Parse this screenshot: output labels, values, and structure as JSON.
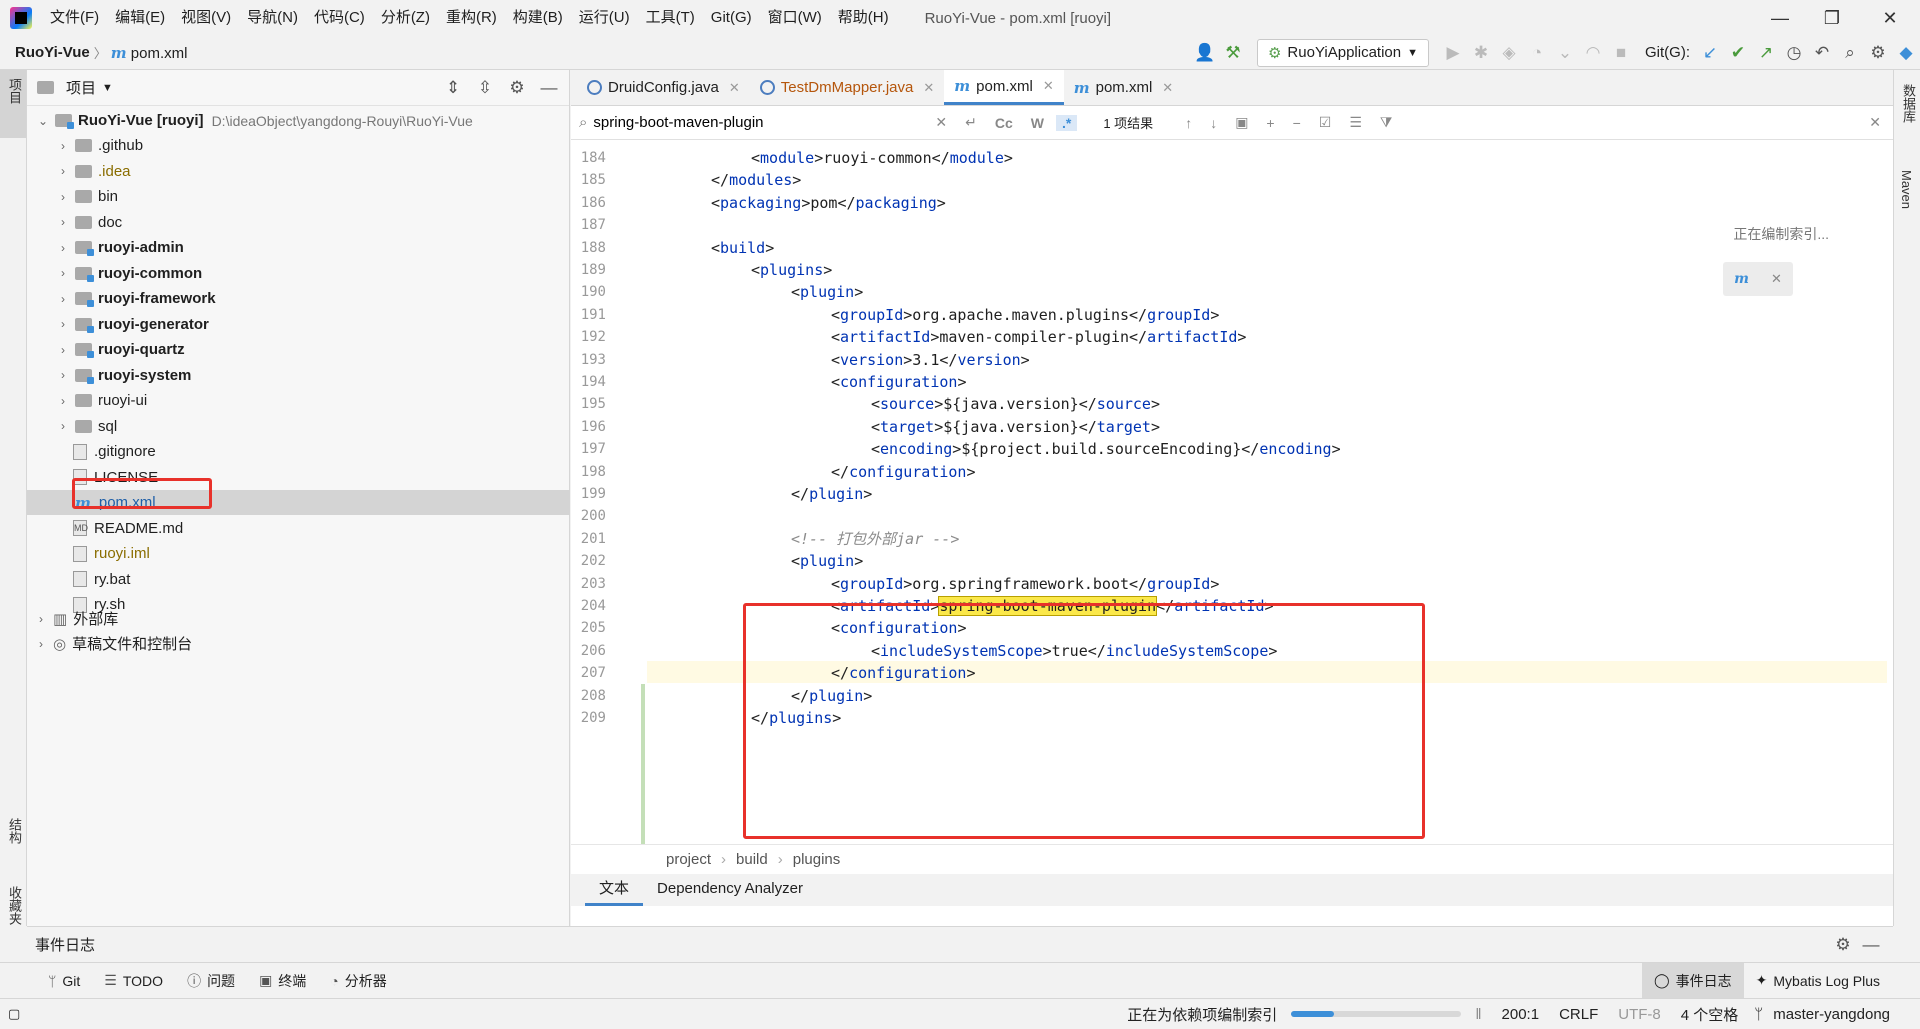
{
  "window": {
    "title": "RuoYi-Vue - pom.xml [ruoyi]",
    "minimize": "—",
    "maximize": "❐",
    "close": "✕"
  },
  "menu": [
    "文件(F)",
    "编辑(E)",
    "视图(V)",
    "导航(N)",
    "代码(C)",
    "分析(Z)",
    "重构(R)",
    "构建(B)",
    "运行(U)",
    "工具(T)",
    "Git(G)",
    "窗口(W)",
    "帮助(H)"
  ],
  "navbar": {
    "project": "RuoYi-Vue",
    "file": "pom.xml",
    "run_config": "RuoYiApplication",
    "git_label": "Git(G):"
  },
  "left_stripe": {
    "project": "项目",
    "structure": "结构",
    "favorites": "收藏夹"
  },
  "right_stripe": {
    "database": "数据库",
    "maven": "Maven"
  },
  "project_panel": {
    "title": "项目",
    "root_name": "RuoYi-Vue [ruoyi]",
    "root_path": "D:\\ideaObject\\yangdong-Rouyi\\RuoYi-Vue",
    "items": [
      {
        "label": ".github",
        "kind": "folder"
      },
      {
        "label": ".idea",
        "kind": "folder-orange"
      },
      {
        "label": "bin",
        "kind": "folder"
      },
      {
        "label": "doc",
        "kind": "folder"
      },
      {
        "label": "ruoyi-admin",
        "kind": "module"
      },
      {
        "label": "ruoyi-common",
        "kind": "module"
      },
      {
        "label": "ruoyi-framework",
        "kind": "module"
      },
      {
        "label": "ruoyi-generator",
        "kind": "module"
      },
      {
        "label": "ruoyi-quartz",
        "kind": "module"
      },
      {
        "label": "ruoyi-system",
        "kind": "module"
      },
      {
        "label": "ruoyi-ui",
        "kind": "folder"
      },
      {
        "label": "sql",
        "kind": "folder"
      },
      {
        "label": ".gitignore",
        "kind": "file"
      },
      {
        "label": "LICENSE",
        "kind": "file"
      },
      {
        "label": "pom.xml",
        "kind": "maven"
      },
      {
        "label": "README.md",
        "kind": "md"
      },
      {
        "label": "ruoyi.iml",
        "kind": "file-orange"
      },
      {
        "label": "ry.bat",
        "kind": "file"
      },
      {
        "label": "ry.sh",
        "kind": "file"
      }
    ],
    "external_libs": "外部库",
    "scratches": "草稿文件和控制台"
  },
  "tabs": [
    {
      "label": "DruidConfig.java",
      "active": false
    },
    {
      "label": "TestDmMapper.java",
      "active": false
    },
    {
      "label": "pom.xml",
      "active": true
    },
    {
      "label": "pom.xml",
      "active": false
    }
  ],
  "search": {
    "value": "spring-boot-maven-plugin",
    "case_btn": "Cc",
    "word_btn": "W",
    "regex_btn": ".*",
    "result": "1 项结果"
  },
  "editor": {
    "indexing_note": "正在编制索引...",
    "lines": [
      {
        "n": "184",
        "indent": 2,
        "parts": [
          [
            "br",
            "<"
          ],
          [
            "tag",
            "module"
          ],
          [
            "br",
            ">"
          ],
          [
            "txt",
            "ruoyi-common"
          ],
          [
            "br",
            "</"
          ],
          [
            "tag",
            "module"
          ],
          [
            "br",
            ">"
          ]
        ]
      },
      {
        "n": "185",
        "indent": 1,
        "parts": [
          [
            "br",
            "</"
          ],
          [
            "tag",
            "modules"
          ],
          [
            "br",
            ">"
          ]
        ]
      },
      {
        "n": "186",
        "indent": 1,
        "parts": [
          [
            "br",
            "<"
          ],
          [
            "tag",
            "packaging"
          ],
          [
            "br",
            ">"
          ],
          [
            "txt",
            "pom"
          ],
          [
            "br",
            "</"
          ],
          [
            "tag",
            "packaging"
          ],
          [
            "br",
            ">"
          ]
        ]
      },
      {
        "n": "187",
        "indent": 0,
        "parts": []
      },
      {
        "n": "188",
        "indent": 1,
        "parts": [
          [
            "br",
            "<"
          ],
          [
            "tag",
            "build"
          ],
          [
            "br",
            ">"
          ]
        ]
      },
      {
        "n": "189",
        "indent": 2,
        "parts": [
          [
            "br",
            "<"
          ],
          [
            "tag",
            "plugins"
          ],
          [
            "br",
            ">"
          ]
        ]
      },
      {
        "n": "190",
        "indent": 3,
        "parts": [
          [
            "br",
            "<"
          ],
          [
            "tag",
            "plugin"
          ],
          [
            "br",
            ">"
          ]
        ]
      },
      {
        "n": "191",
        "indent": 4,
        "parts": [
          [
            "br",
            "<"
          ],
          [
            "tag",
            "groupId"
          ],
          [
            "br",
            ">"
          ],
          [
            "txt",
            "org.apache.maven.plugins"
          ],
          [
            "br",
            "</"
          ],
          [
            "tag",
            "groupId"
          ],
          [
            "br",
            ">"
          ]
        ]
      },
      {
        "n": "192",
        "indent": 4,
        "parts": [
          [
            "br",
            "<"
          ],
          [
            "tag",
            "artifactId"
          ],
          [
            "br",
            ">"
          ],
          [
            "txt",
            "maven-compiler-plugin"
          ],
          [
            "br",
            "</"
          ],
          [
            "tag",
            "artifactId"
          ],
          [
            "br",
            ">"
          ]
        ]
      },
      {
        "n": "193",
        "indent": 4,
        "parts": [
          [
            "br",
            "<"
          ],
          [
            "tag",
            "version"
          ],
          [
            "br",
            ">"
          ],
          [
            "txt",
            "3.1"
          ],
          [
            "br",
            "</"
          ],
          [
            "tag",
            "version"
          ],
          [
            "br",
            ">"
          ]
        ]
      },
      {
        "n": "194",
        "indent": 4,
        "parts": [
          [
            "br",
            "<"
          ],
          [
            "tag",
            "configuration"
          ],
          [
            "br",
            ">"
          ]
        ]
      },
      {
        "n": "195",
        "indent": 5,
        "parts": [
          [
            "br",
            "<"
          ],
          [
            "tag",
            "source"
          ],
          [
            "br",
            ">"
          ],
          [
            "txt",
            "${java.version}"
          ],
          [
            "br",
            "</"
          ],
          [
            "tag",
            "source"
          ],
          [
            "br",
            ">"
          ]
        ]
      },
      {
        "n": "196",
        "indent": 5,
        "parts": [
          [
            "br",
            "<"
          ],
          [
            "tag",
            "target"
          ],
          [
            "br",
            ">"
          ],
          [
            "txt",
            "${java.version}"
          ],
          [
            "br",
            "</"
          ],
          [
            "tag",
            "target"
          ],
          [
            "br",
            ">"
          ]
        ]
      },
      {
        "n": "197",
        "indent": 5,
        "parts": [
          [
            "br",
            "<"
          ],
          [
            "tag",
            "encoding"
          ],
          [
            "br",
            ">"
          ],
          [
            "txt",
            "${project.build.sourceEncoding}"
          ],
          [
            "br",
            "</"
          ],
          [
            "tag",
            "encoding"
          ],
          [
            "br",
            ">"
          ]
        ]
      },
      {
        "n": "198",
        "indent": 4,
        "parts": [
          [
            "br",
            "</"
          ],
          [
            "tag",
            "configuration"
          ],
          [
            "br",
            ">"
          ]
        ]
      },
      {
        "n": "199",
        "indent": 3,
        "parts": [
          [
            "br",
            "</"
          ],
          [
            "tag",
            "plugin"
          ],
          [
            "br",
            ">"
          ]
        ]
      },
      {
        "n": "200",
        "indent": 0,
        "parts": []
      },
      {
        "n": "201",
        "indent": 3,
        "parts": [
          [
            "cmt",
            "<!-- 打包外部jar -->"
          ]
        ]
      },
      {
        "n": "202",
        "indent": 3,
        "parts": [
          [
            "br",
            "<"
          ],
          [
            "tag",
            "plugin"
          ],
          [
            "br",
            ">"
          ]
        ]
      },
      {
        "n": "203",
        "indent": 4,
        "parts": [
          [
            "br",
            "<"
          ],
          [
            "tag",
            "groupId"
          ],
          [
            "br",
            ">"
          ],
          [
            "txt",
            "org.springframework.boot"
          ],
          [
            "br",
            "</"
          ],
          [
            "tag",
            "groupId"
          ],
          [
            "br",
            ">"
          ]
        ]
      },
      {
        "n": "204",
        "indent": 4,
        "parts": [
          [
            "br",
            "<"
          ],
          [
            "tag",
            "artifactId"
          ],
          [
            "br",
            ">"
          ],
          [
            "hl",
            "spring-boot-maven-plugin"
          ],
          [
            "br",
            "</"
          ],
          [
            "tag",
            "artifactId"
          ],
          [
            "br",
            ">"
          ]
        ]
      },
      {
        "n": "205",
        "indent": 4,
        "parts": [
          [
            "br",
            "<"
          ],
          [
            "tag",
            "configuration"
          ],
          [
            "br",
            ">"
          ]
        ]
      },
      {
        "n": "206",
        "indent": 5,
        "parts": [
          [
            "br",
            "<"
          ],
          [
            "tag",
            "includeSystemScope"
          ],
          [
            "br",
            ">"
          ],
          [
            "txt",
            "true"
          ],
          [
            "br",
            "</"
          ],
          [
            "tag",
            "includeSystemScope"
          ],
          [
            "br",
            ">"
          ]
        ]
      },
      {
        "n": "207",
        "indent": 4,
        "parts": [
          [
            "br",
            "</"
          ],
          [
            "tag",
            "configuration"
          ],
          [
            "br",
            ">"
          ]
        ]
      },
      {
        "n": "208",
        "indent": 3,
        "parts": [
          [
            "br",
            "</"
          ],
          [
            "tag",
            "plugin"
          ],
          [
            "br",
            ">"
          ]
        ]
      },
      {
        "n": "209",
        "indent": 2,
        "parts": [
          [
            "br",
            "</"
          ],
          [
            "tag",
            "plugins"
          ],
          [
            "br",
            ">"
          ]
        ]
      }
    ],
    "breadcrumb": [
      "project",
      "build",
      "plugins"
    ],
    "bottom_tabs": [
      {
        "label": "文本",
        "active": true
      },
      {
        "label": "Dependency Analyzer",
        "active": false
      }
    ]
  },
  "event_log": {
    "title": "事件日志"
  },
  "tool_windows": [
    {
      "label": "Git",
      "icon": "git-icon"
    },
    {
      "label": "TODO",
      "icon": "todo-icon"
    },
    {
      "label": "问题",
      "icon": "problems-icon"
    },
    {
      "label": "终端",
      "icon": "terminal-icon"
    },
    {
      "label": "分析器",
      "icon": "profiler-icon"
    }
  ],
  "tool_windows_right": [
    {
      "label": "事件日志",
      "active": true
    },
    {
      "label": "Mybatis Log Plus",
      "active": false
    }
  ],
  "status": {
    "indexing": "正在为依赖项编制索引",
    "progress": 0.25,
    "position": "200:1",
    "line_sep": "CRLF",
    "encoding": "UTF-8",
    "indent": "4 个空格",
    "branch": "master-yangdong"
  },
  "colors": {
    "accent": "#4083c9",
    "highlight": "#fbe84a",
    "annotation_box": "#e8312a",
    "xml_tag": "#0033b3"
  }
}
